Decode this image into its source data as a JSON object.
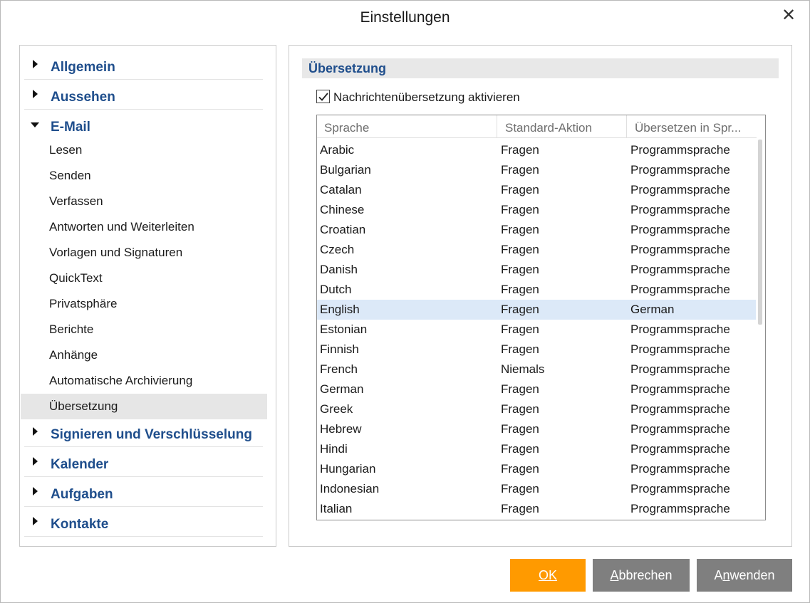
{
  "window": {
    "title": "Einstellungen",
    "close_icon": "close-icon"
  },
  "nav": {
    "categories": [
      {
        "label": "Allgemein",
        "expanded": false
      },
      {
        "label": "Aussehen",
        "expanded": false
      },
      {
        "label": "E-Mail",
        "expanded": true
      },
      {
        "label": "Signieren und Verschlüsselung",
        "expanded": false
      },
      {
        "label": "Kalender",
        "expanded": false
      },
      {
        "label": "Aufgaben",
        "expanded": false
      },
      {
        "label": "Kontakte",
        "expanded": false
      }
    ],
    "email_items": [
      {
        "label": "Lesen"
      },
      {
        "label": "Senden"
      },
      {
        "label": "Verfassen"
      },
      {
        "label": "Antworten und Weiterleiten"
      },
      {
        "label": "Vorlagen und Signaturen"
      },
      {
        "label": "QuickText"
      },
      {
        "label": "Privatsphäre"
      },
      {
        "label": "Berichte"
      },
      {
        "label": "Anhänge"
      },
      {
        "label": "Automatische Archivierung"
      },
      {
        "label": "Übersetzung",
        "active": true
      }
    ]
  },
  "content": {
    "section_title": "Übersetzung",
    "enable_checkbox": {
      "label": "Nachrichtenübersetzung aktivieren",
      "checked": true
    },
    "table": {
      "columns": [
        "Sprache",
        "Standard-Aktion",
        "Übersetzen in Spr..."
      ],
      "rows": [
        [
          "Arabic",
          "Fragen",
          "Programmsprache"
        ],
        [
          "Bulgarian",
          "Fragen",
          "Programmsprache"
        ],
        [
          "Catalan",
          "Fragen",
          "Programmsprache"
        ],
        [
          "Chinese",
          "Fragen",
          "Programmsprache"
        ],
        [
          "Croatian",
          "Fragen",
          "Programmsprache"
        ],
        [
          "Czech",
          "Fragen",
          "Programmsprache"
        ],
        [
          "Danish",
          "Fragen",
          "Programmsprache"
        ],
        [
          "Dutch",
          "Fragen",
          "Programmsprache"
        ],
        [
          "English",
          "Fragen",
          "German"
        ],
        [
          "Estonian",
          "Fragen",
          "Programmsprache"
        ],
        [
          "Finnish",
          "Fragen",
          "Programmsprache"
        ],
        [
          "French",
          "Niemals",
          "Programmsprache"
        ],
        [
          "German",
          "Fragen",
          "Programmsprache"
        ],
        [
          "Greek",
          "Fragen",
          "Programmsprache"
        ],
        [
          "Hebrew",
          "Fragen",
          "Programmsprache"
        ],
        [
          "Hindi",
          "Fragen",
          "Programmsprache"
        ],
        [
          "Hungarian",
          "Fragen",
          "Programmsprache"
        ],
        [
          "Indonesian",
          "Fragen",
          "Programmsprache"
        ],
        [
          "Italian",
          "Fragen",
          "Programmsprache"
        ]
      ],
      "selected_row_index": 8
    }
  },
  "buttons": {
    "ok": {
      "label": "OK"
    },
    "cancel": {
      "prefix": "",
      "mnemonic": "A",
      "rest": "bbrechen"
    },
    "apply": {
      "prefix": "A",
      "mnemonic": "n",
      "rest": "wenden"
    }
  },
  "colors": {
    "accent_blue": "#1f4e8c",
    "ok_orange": "#ff9a00",
    "button_gray": "#7f7f7f",
    "selected_row": "#dce9f8",
    "active_nav": "#e6e6e6"
  }
}
